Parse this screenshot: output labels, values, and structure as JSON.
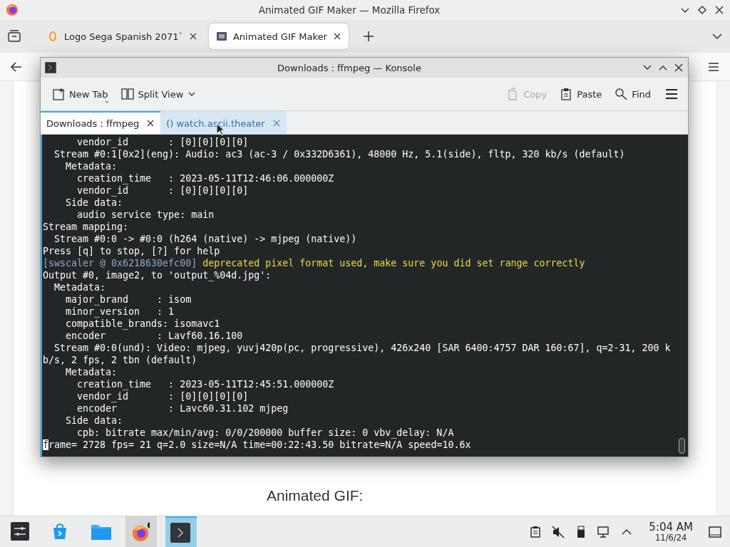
{
  "firefox": {
    "title": "Animated GIF Maker — Mozilla Firefox",
    "tabs": [
      {
        "label": "Logo Sega Spanish 2071`",
        "kind": "coin",
        "selected": false
      },
      {
        "label": "Animated GIF Maker",
        "kind": "film",
        "selected": true
      }
    ],
    "page": {
      "heading": "Animated GIF:"
    }
  },
  "konsole": {
    "title": "Downloads : ffmpeg — Konsole",
    "toolbar": [
      {
        "kind": "new-tab",
        "label": "New Tab",
        "disabled": false
      },
      {
        "kind": "split",
        "label": "Split View",
        "disabled": false
      },
      {
        "kind": "copy",
        "label": "Copy",
        "disabled": true
      },
      {
        "kind": "paste",
        "label": "Paste",
        "disabled": false
      },
      {
        "kind": "find",
        "label": "Find",
        "disabled": false
      }
    ],
    "tabs": [
      {
        "label": "Downloads : ffmpeg",
        "selected": true
      },
      {
        "label": "() watch.ascii.theater",
        "selected": false
      }
    ],
    "lines": [
      {
        "text": "      vendor_id       : [0][0][0][0]"
      },
      {
        "text": "  Stream #0:1[0x2](eng): Audio: ac3 (ac-3 / 0x332D6361), 48000 Hz, 5.1(side), fltp, 320 kb/s (default)"
      },
      {
        "text": "    Metadata:"
      },
      {
        "text": "      creation_time   : 2023-05-11T12:46:06.000000Z"
      },
      {
        "text": "      vendor_id       : [0][0][0][0]"
      },
      {
        "text": "    Side data:"
      },
      {
        "text": "      audio service type: main"
      },
      {
        "text": "Stream mapping:"
      },
      {
        "text": "  Stream #0:0 -> #0:0 (h264 (native) -> mjpeg (native))"
      },
      {
        "text": "Press [q] to stop, [?] for help"
      },
      {
        "segments": [
          {
            "kind": "source",
            "text": "[swscaler @ 0x6218630efc00]"
          },
          {
            "kind": "warning",
            "text": "deprecated pixel format used, make sure you did set range correctly"
          }
        ]
      },
      {
        "text": "Output #0, image2, to 'output_%04d.jpg':"
      },
      {
        "text": "  Metadata:"
      },
      {
        "text": "    major_brand     : isom"
      },
      {
        "text": "    minor_version   : 1"
      },
      {
        "text": "    compatible_brands: isomavc1"
      },
      {
        "text": "    encoder         : Lavf60.16.100"
      },
      {
        "text": "  Stream #0:0(und): Video: mjpeg, yuvj420p(pc, progressive), 426x240 [SAR 6400:4757 DAR 160:67], q=2-31, 200 k"
      },
      {
        "text": "b/s, 2 fps, 2 tbn (default)"
      },
      {
        "text": "    Metadata:"
      },
      {
        "text": "      creation_time   : 2023-05-11T12:45:51.000000Z"
      },
      {
        "text": "      vendor_id       : [0][0][0][0]"
      },
      {
        "text": "      encoder         : Lavc60.31.102 mjpeg"
      },
      {
        "text": "    Side data:"
      },
      {
        "text": "      cpb: bitrate max/min/avg: 0/0/200000 buffer size: 0 vbv_delay: N/A"
      },
      {
        "text": "frame= 2728 fps= 21 q=2.0 size=N/A time=00:22:43.50 bitrate=N/A speed=10.6x",
        "cursor": true
      }
    ]
  },
  "taskbar": {
    "tasks": [
      {
        "kind": "launcher",
        "highlighted": false,
        "active": false
      },
      {
        "kind": "store",
        "highlighted": false,
        "active": false
      },
      {
        "kind": "files",
        "highlighted": false,
        "active": false
      },
      {
        "kind": "browser",
        "highlighted": true,
        "active": false
      },
      {
        "kind": "terminal",
        "highlighted": false,
        "active": true
      }
    ],
    "tray": [
      {
        "kind": "clipboard"
      },
      {
        "kind": "muted"
      },
      {
        "kind": "usb"
      },
      {
        "kind": "network"
      },
      {
        "kind": "expand"
      }
    ],
    "clock": {
      "time": "5:04 AM",
      "date": "11/6/24"
    }
  }
}
